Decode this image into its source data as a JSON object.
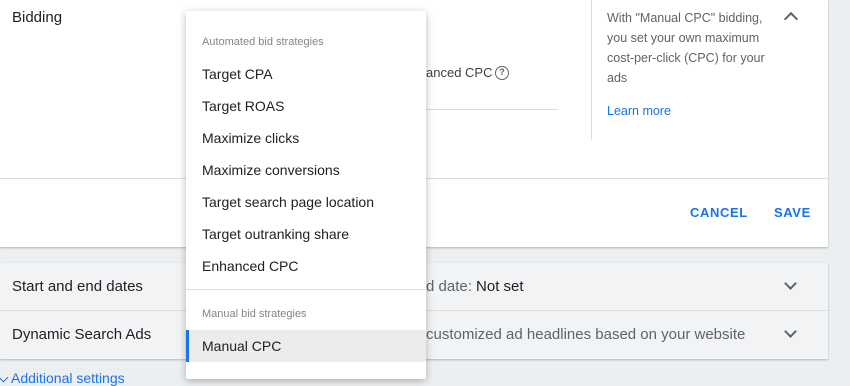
{
  "bidding": {
    "title": "Bidding",
    "behind_option_label": "anced CPC",
    "help_text": "With \"Manual CPC\" bidding, you set your own maximum cost-per-click (CPC) for your ads",
    "learn_more": "Learn more",
    "cancel_label": "CANCEL",
    "save_label": "SAVE"
  },
  "dropdown": {
    "automated_header": "Automated bid strategies",
    "automated_items": [
      "Target CPA",
      "Target ROAS",
      "Maximize clicks",
      "Maximize conversions",
      "Target search page location",
      "Target outranking share",
      "Enhanced CPC"
    ],
    "manual_header": "Manual bid strategies",
    "manual_items": [
      "Manual CPC"
    ],
    "selected": "Manual CPC"
  },
  "panels": [
    {
      "title": "Start and end dates",
      "summary_prefix": "d date: ",
      "summary_value": "Not set"
    },
    {
      "title": "Dynamic Search Ads",
      "summary_prefix": "customized ad headlines based on your website",
      "summary_value": ""
    }
  ],
  "additional_settings": "Additional settings",
  "colors": {
    "accent": "#1a73e8",
    "panel_bg": "#f1f3f4",
    "page_bg": "#eceff1"
  }
}
